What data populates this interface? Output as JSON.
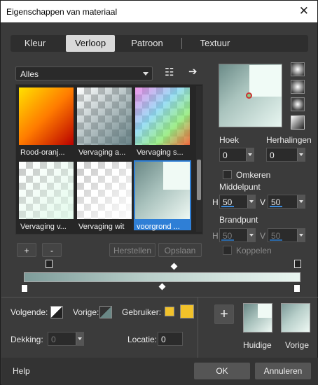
{
  "window": {
    "title": "Eigenschappen van materiaal",
    "close": "✕"
  },
  "tabs": [
    {
      "label": "Kleur"
    },
    {
      "label": "Verloop"
    },
    {
      "label": "Patroon"
    },
    {
      "label": "Textuur"
    }
  ],
  "category": {
    "value": "Alles"
  },
  "gallery": {
    "items": [
      {
        "label": "Rood-oranj..."
      },
      {
        "label": "Vervaging a..."
      },
      {
        "label": "Vervaging s..."
      },
      {
        "label": "Vervaging v..."
      },
      {
        "label": "Vervaging wit"
      },
      {
        "label": "voorgrond ..."
      }
    ]
  },
  "buttons": {
    "add": "+",
    "remove": "-",
    "restore": "Herstellen",
    "save": "Opslaan"
  },
  "settings": {
    "angle_label": "Hoek",
    "angle_value": "0",
    "repeat_label": "Herhalingen",
    "repeat_value": "0",
    "invert_label": "Omkeren",
    "midpoint_label": "Middelpunt",
    "mid_h_label": "H",
    "mid_h_value": "50",
    "mid_v_label": "V",
    "mid_v_value": "50",
    "focus_label": "Brandpunt",
    "focus_h_label": "H",
    "focus_h_value": "50",
    "focus_v_label": "V",
    "focus_v_value": "50",
    "link_label": "Koppelen"
  },
  "bottom": {
    "next_label": "Volgende:",
    "prev_label": "Vorige:",
    "user_label": "Gebruiker:",
    "opacity_label": "Dekking:",
    "opacity_value": "0",
    "location_label": "Locatie:",
    "location_value": "0",
    "current_label": "Huidige",
    "previous_label": "Vorige",
    "user_color": "#f2c22a"
  },
  "footer": {
    "help": "Help",
    "ok": "OK",
    "cancel": "Annuleren"
  }
}
